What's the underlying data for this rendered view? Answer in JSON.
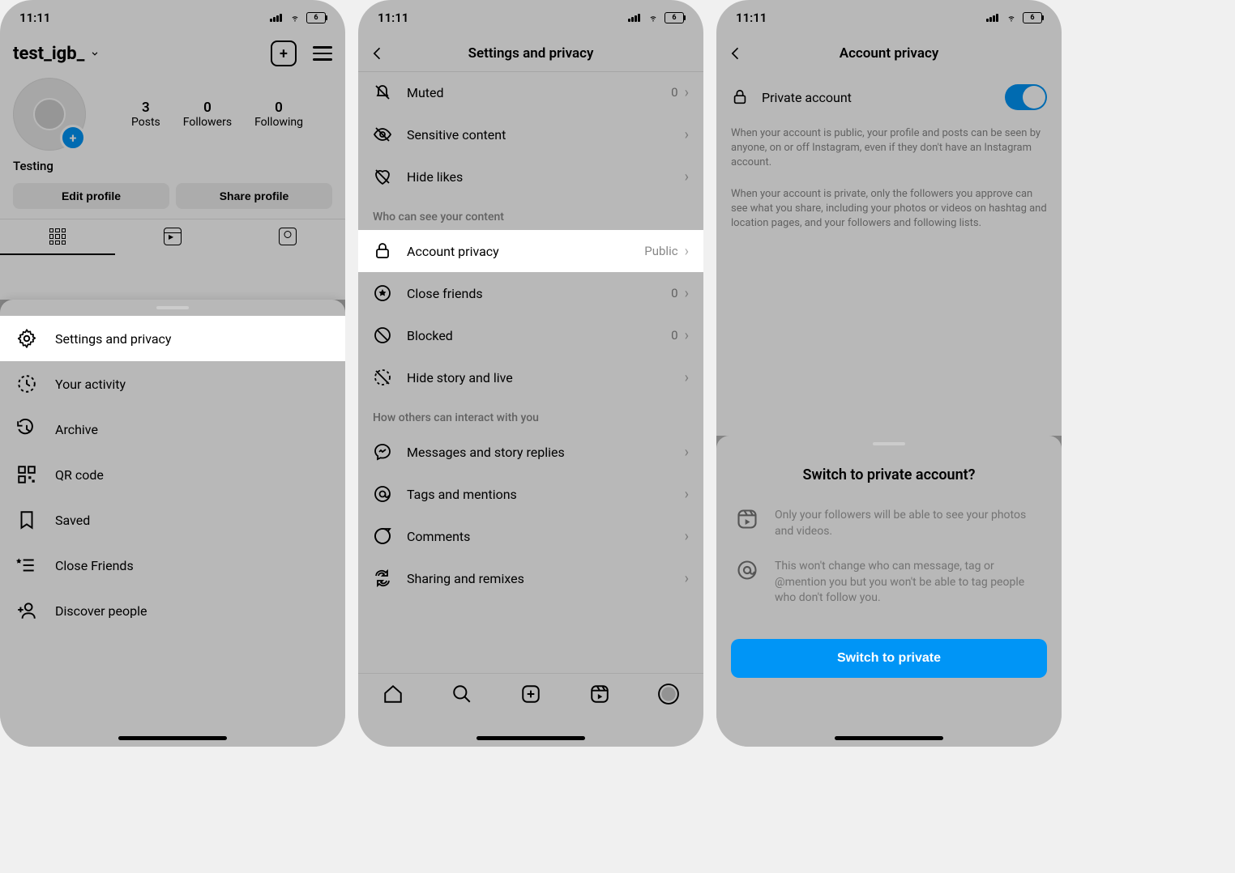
{
  "status": {
    "time": "11:11",
    "battery": "6"
  },
  "phone1": {
    "username": "test_igb_",
    "stats": {
      "posts_n": "3",
      "posts_l": "Posts",
      "followers_n": "0",
      "followers_l": "Followers",
      "following_n": "0",
      "following_l": "Following"
    },
    "display_name": "Testing",
    "edit_btn": "Edit profile",
    "share_btn": "Share profile",
    "menu": {
      "settings": "Settings and privacy",
      "activity": "Your activity",
      "archive": "Archive",
      "qr": "QR code",
      "saved": "Saved",
      "close_friends": "Close Friends",
      "discover": "Discover people"
    }
  },
  "phone2": {
    "title": "Settings and privacy",
    "muted": "Muted",
    "muted_n": "0",
    "sensitive": "Sensitive content",
    "hide_likes": "Hide likes",
    "section_see": "Who can see your content",
    "account_privacy": "Account privacy",
    "account_privacy_val": "Public",
    "close_friends": "Close friends",
    "close_friends_n": "0",
    "blocked": "Blocked",
    "blocked_n": "0",
    "hide_story": "Hide story and live",
    "section_interact": "How others can interact with you",
    "messages": "Messages and story replies",
    "tags": "Tags and mentions",
    "comments": "Comments",
    "sharing": "Sharing and remixes"
  },
  "phone3": {
    "title": "Account privacy",
    "private_label": "Private account",
    "info1": "When your account is public, your profile and posts can be seen by anyone, on or off Instagram, even if they don't have an Instagram account.",
    "info2": "When your account is private, only the followers you approve can see what you share, including your photos or videos on hashtag and location pages, and your followers and following lists.",
    "sheet_title": "Switch to private account?",
    "sheet_row1": "Only your followers will be able to see your photos and videos.",
    "sheet_row2": "This won't change who can message, tag or @mention you but you won't be able to tag people who don't follow you.",
    "switch_btn": "Switch to private"
  }
}
